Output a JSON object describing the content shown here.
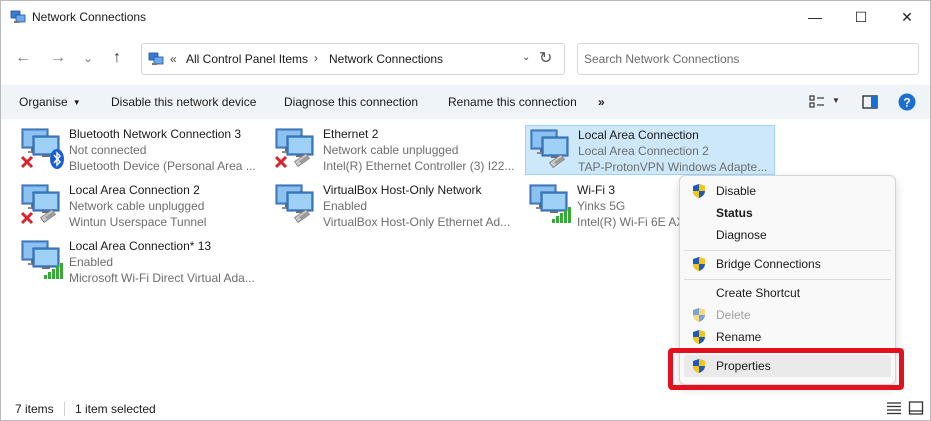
{
  "window": {
    "title": "Network Connections",
    "minimize_glyph": "—",
    "maximize_glyph": "☐",
    "close_glyph": "✕"
  },
  "address_bar": {
    "chevron": "«",
    "crumbs": [
      "All Control Panel Items",
      "Network Connections"
    ],
    "separator": "›",
    "dropdown_glyph": "⌄",
    "refresh_glyph": "↻"
  },
  "nav": {
    "back_glyph": "←",
    "forward_glyph": "→",
    "recent_glyph": "⌄",
    "up_glyph": "↑"
  },
  "search": {
    "placeholder": "Search Network Connections",
    "value": ""
  },
  "toolbar": {
    "organise": "Organise",
    "disable": "Disable this network device",
    "diagnose": "Diagnose this connection",
    "rename": "Rename this connection",
    "more": "»"
  },
  "connections": [
    {
      "name": "Bluetooth Network Connection 3",
      "status": "Not connected",
      "device": "Bluetooth Device (Personal Area ...",
      "state": "disconnected",
      "badge": "bluetooth-icon"
    },
    {
      "name": "Ethernet 2",
      "status": "Network cable unplugged",
      "device": "Intel(R) Ethernet Controller (3) I22...",
      "state": "disconnected",
      "badge": "cable-icon"
    },
    {
      "name": "Local Area Connection",
      "status": "Local Area Connection 2",
      "device": "TAP-ProtonVPN Windows Adapte...",
      "state": "connected",
      "badge": "cable-icon"
    },
    {
      "name": "Local Area Connection 2",
      "status": "Network cable unplugged",
      "device": "Wintun Userspace Tunnel",
      "state": "disconnected",
      "badge": "cable-icon"
    },
    {
      "name": "VirtualBox Host-Only Network",
      "status": "Enabled",
      "device": "VirtualBox Host-Only Ethernet Ad...",
      "state": "connected",
      "badge": "cable-icon"
    },
    {
      "name": "Wi-Fi 3",
      "status": "Yinks 5G",
      "device": "Intel(R) Wi-Fi 6E AX",
      "state": "connected",
      "badge": "signal-icon"
    },
    {
      "name": "Local Area Connection* 13",
      "status": "Enabled",
      "device": "Microsoft Wi-Fi Direct Virtual Ada...",
      "state": "connected",
      "badge": "signal-icon"
    }
  ],
  "context_menu": {
    "items": [
      {
        "label": "Disable",
        "shield": true
      },
      {
        "label": "Status",
        "bold": true
      },
      {
        "label": "Diagnose"
      },
      {
        "label": "Bridge Connections",
        "shield": true
      },
      {
        "label": "Create Shortcut"
      },
      {
        "label": "Delete",
        "shield": true,
        "disabled": true
      },
      {
        "label": "Rename",
        "shield": true
      },
      {
        "label": "Properties",
        "shield": true,
        "hover": true
      }
    ]
  },
  "status_bar": {
    "count": "7 items",
    "selected": "1 item selected"
  },
  "colors": {
    "selection": "#cde8fb",
    "highlight_border": "#e3101d",
    "help_blue": "#1a6fd1"
  }
}
